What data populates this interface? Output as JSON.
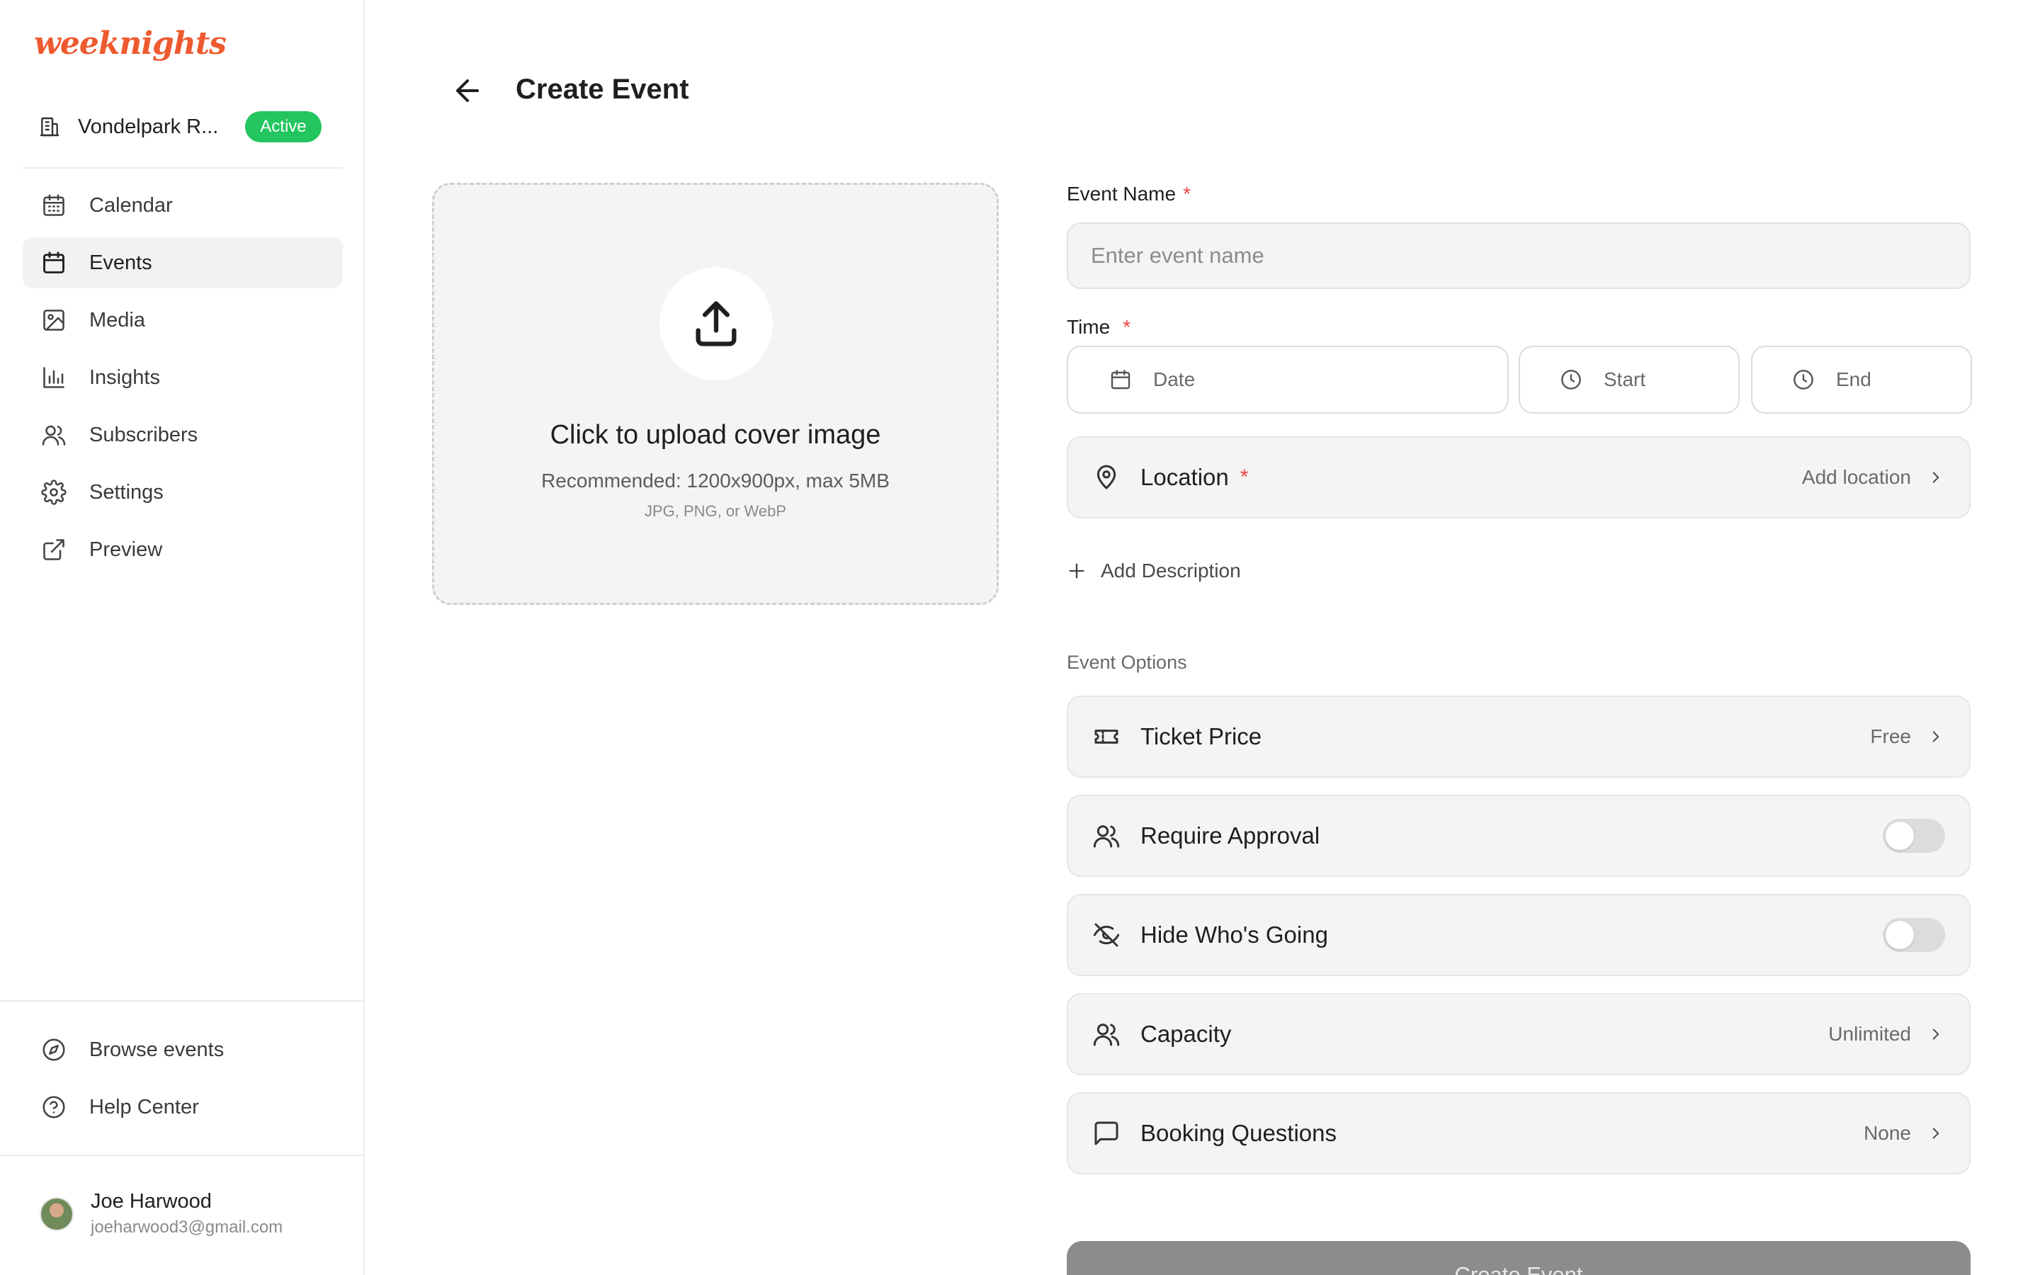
{
  "app": {
    "logo_text": "weeknights",
    "brand_color": "#ee5a2f"
  },
  "workspace": {
    "name": "Vondelpark R...",
    "status": "Active",
    "status_color": "#22c55e"
  },
  "sidebar": {
    "items": [
      {
        "label": "Calendar",
        "icon": "calendar-icon"
      },
      {
        "label": "Events",
        "icon": "calendar-event-icon",
        "active": true
      },
      {
        "label": "Media",
        "icon": "image-icon"
      },
      {
        "label": "Insights",
        "icon": "bar-chart-icon"
      },
      {
        "label": "Subscribers",
        "icon": "users-icon"
      },
      {
        "label": "Settings",
        "icon": "gear-icon"
      },
      {
        "label": "Preview",
        "icon": "external-link-icon"
      }
    ],
    "footer_items": [
      {
        "label": "Browse events",
        "icon": "compass-icon"
      },
      {
        "label": "Help Center",
        "icon": "help-circle-icon"
      }
    ]
  },
  "user": {
    "name": "Joe Harwood",
    "email": "joeharwood3@gmail.com"
  },
  "page": {
    "title": "Create Event"
  },
  "upload": {
    "title": "Click to upload cover image",
    "recommendation": "Recommended: 1200x900px, max 5MB",
    "formats": "JPG, PNG, or WebP"
  },
  "form": {
    "event_name_label": "Event Name",
    "event_name_placeholder": "Enter event name",
    "event_name_value": "",
    "time_label": "Time",
    "date_placeholder": "Date",
    "start_placeholder": "Start",
    "end_placeholder": "End",
    "required_marker": "*",
    "location_label": "Location",
    "location_value": "Add location",
    "add_description": "Add Description"
  },
  "options": {
    "section_title": "Event Options",
    "ticket_price": {
      "label": "Ticket Price",
      "value": "Free"
    },
    "require_approval": {
      "label": "Require Approval",
      "enabled": false
    },
    "hide_whos_going": {
      "label": "Hide Who's Going",
      "enabled": false
    },
    "capacity": {
      "label": "Capacity",
      "value": "Unlimited"
    },
    "booking_questions": {
      "label": "Booking Questions",
      "value": "None"
    }
  },
  "actions": {
    "create_label": "Create Event"
  }
}
